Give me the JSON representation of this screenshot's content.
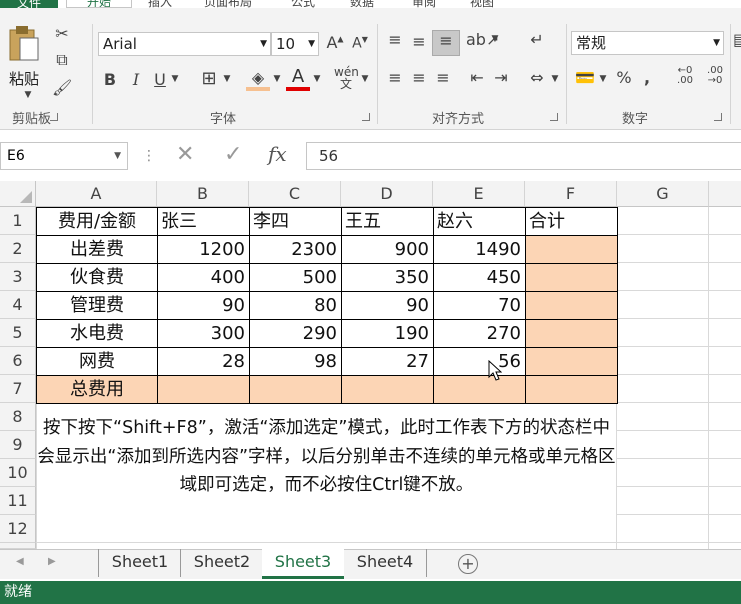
{
  "ribbon_tabs": [
    "文件",
    "开始",
    "插入",
    "页面布局",
    "公式",
    "数据",
    "审阅",
    "视图"
  ],
  "clipboard": {
    "paste_label": "粘贴",
    "group_label": "剪贴板"
  },
  "font": {
    "family": "Arial",
    "size": "10",
    "group_label": "字体"
  },
  "alignment": {
    "group_label": "对齐方式"
  },
  "number": {
    "format": "常规",
    "group_label": "数字"
  },
  "formula_bar": {
    "name_box": "E6",
    "fx": "fx",
    "value": "56"
  },
  "columns": [
    "A",
    "B",
    "C",
    "D",
    "E",
    "F",
    "G"
  ],
  "rows": [
    "1",
    "2",
    "3",
    "4",
    "5",
    "6",
    "7",
    "8",
    "9",
    "10",
    "11",
    "12"
  ],
  "table": {
    "header": [
      "费用/金额",
      "张三",
      "李四",
      "王五",
      "赵六",
      "合计"
    ],
    "body": [
      [
        "出差费",
        "1200",
        "2300",
        "900",
        "1490",
        ""
      ],
      [
        "伙食费",
        "400",
        "500",
        "350",
        "450",
        ""
      ],
      [
        "管理费",
        "90",
        "80",
        "90",
        "70",
        ""
      ],
      [
        "水电费",
        "300",
        "290",
        "190",
        "270",
        ""
      ],
      [
        "网费",
        "28",
        "98",
        "27",
        "56",
        ""
      ],
      [
        "总费用",
        "",
        "",
        "",
        "",
        ""
      ]
    ]
  },
  "note": "按下按下“Shift+F8”，激活“添加选定”模式，此时工作表下方的状态栏中会显示出“添加到所选内容”字样，以后分别单击不连续的单元格或单元格区域即可选定，而不必按住Ctrl键不放。",
  "sheets": [
    "Sheet1",
    "Sheet2",
    "Sheet3",
    "Sheet4"
  ],
  "active_sheet": "Sheet3",
  "status": "就绪",
  "colors": {
    "accent": "#217346",
    "highlight": "#fcd5b5"
  }
}
